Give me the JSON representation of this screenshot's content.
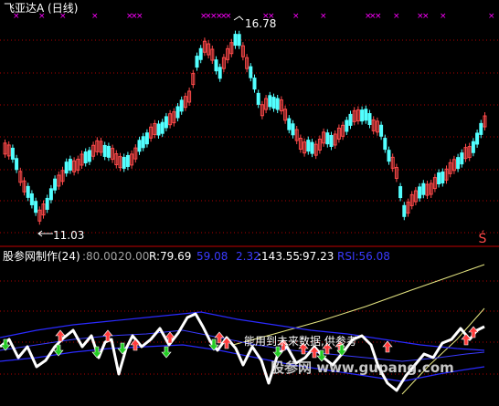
{
  "top_panel": {
    "title": "飞亚达A (日线)",
    "high_label": "16.78",
    "low_label": "11.03",
    "corner_glyph": "Ś",
    "colors": {
      "up": "#ff4a4a",
      "down": "#53ffff",
      "title": "#ffffff",
      "marker": "#ff00ff",
      "grid": "#b00000"
    }
  },
  "indicator_panel": {
    "name": "股参网制作(24)",
    "values": [
      {
        "text": ":80.00",
        "color": "#a0a0a0"
      },
      {
        "text": ":20.00",
        "color": "#a0a0a0"
      },
      {
        "text": "R:79.69",
        "color": "#ffffff"
      },
      {
        "text": "59.08",
        "color": "#3a3aff"
      },
      {
        "text": "2.32",
        "color": "#3a3aff"
      },
      {
        "text": ":143.55",
        "color": "#ffffff"
      },
      {
        "text": ":97.23",
        "color": "#ffffff"
      },
      {
        "text": "RSI:56.08",
        "color": "#3a3aff"
      }
    ],
    "note": "能用到未来数据,供参考"
  },
  "watermark": "股参网 www.gupang.com"
}
